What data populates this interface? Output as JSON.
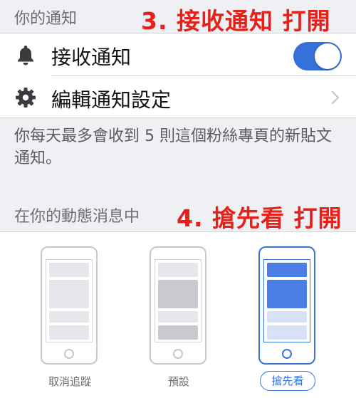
{
  "notifications_section": {
    "title": "你的通知",
    "annotation": "3. 接收通知 打開",
    "receive_row": {
      "icon": "bell-icon",
      "label": "接收通知",
      "toggle_on": true
    },
    "settings_row": {
      "icon": "gear-icon",
      "label": "編輯通知設定"
    },
    "description": "你每天最多會收到 5 則這個粉絲專頁的新貼文通知。"
  },
  "feed_section": {
    "title": "在你的動態消息中",
    "annotation": "4. 搶先看 打開",
    "options": [
      {
        "label": "取消追蹤",
        "selected": false
      },
      {
        "label": "預設",
        "selected": false
      },
      {
        "label": "搶先看",
        "selected": true
      }
    ]
  },
  "colors": {
    "accent": "#3670d9",
    "annotation_red": "#e8201a",
    "background": "#eff0f4"
  }
}
